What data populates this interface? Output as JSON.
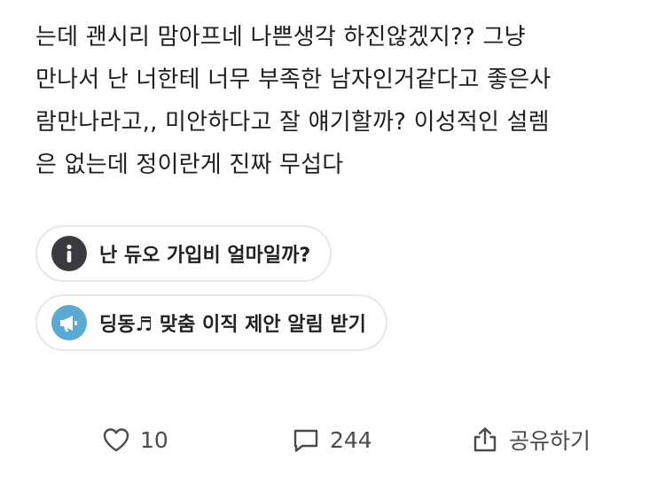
{
  "post": {
    "lines": [
      "는데 괜시리 맘아프네 나쁜생각 하진않겠지??  그냥",
      "만나서 난 너한테 너무 부족한 남자인거같다고 좋은사",
      "람만나라고,, 미안하다고 잘 얘기할까? 이성적인 설렘",
      "은 없는데 정이란게 진짜 무섭다"
    ]
  },
  "chips": [
    {
      "label": "난 듀오 가입비 얼마일까?",
      "icon": "info-icon",
      "color": "#3a3b40"
    },
    {
      "label": "딩동♬ 맞춤 이직 제안 알림 받기",
      "icon": "megaphone-icon",
      "color": "#5aa9d2"
    }
  ],
  "actions": {
    "like_count": "10",
    "comment_count": "244",
    "share_label": "공유하기"
  }
}
